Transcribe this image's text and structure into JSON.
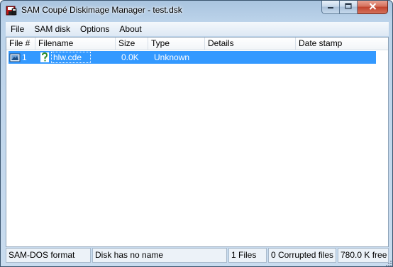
{
  "window": {
    "title": "SAM Coupé Diskimage Manager - test.dsk",
    "icon": "disk-app-icon"
  },
  "caption_buttons": [
    "minimize-icon",
    "maximize-icon",
    "close-icon"
  ],
  "menu": [
    "File",
    "SAM disk",
    "Options",
    "About"
  ],
  "columns": [
    "File #",
    "Filename",
    "Size",
    "Type",
    "Details",
    "Date stamp"
  ],
  "files": [
    {
      "number": "1",
      "filename": "hlw.cde",
      "size": "0.0K",
      "type": "Unknown",
      "details": "",
      "date_stamp": "",
      "selected": true,
      "type_icon": "question-mark-icon"
    }
  ],
  "status": {
    "format": "SAM-DOS format",
    "name": "Disk has no name",
    "files": "1 Files",
    "corrupted": "0 Corrupted files",
    "free": "780.0 K free"
  },
  "colors": {
    "selection": "#3399ff",
    "titlebar": "#bcd3ea",
    "close_button": "#c2432d"
  }
}
